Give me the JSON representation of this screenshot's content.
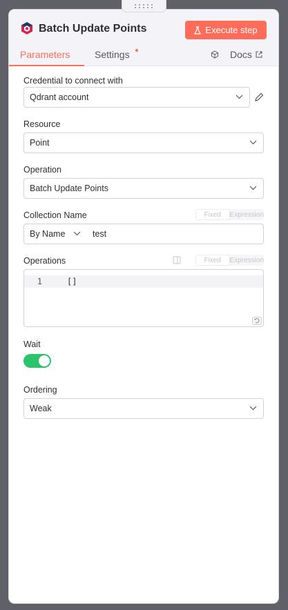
{
  "node": {
    "title": "Batch Update Points",
    "execute_label": "Execute step",
    "accent": "#ff6d5a",
    "icon": "qdrant-icon"
  },
  "tabs": {
    "parameters": "Parameters",
    "settings": "Settings",
    "docs": "Docs"
  },
  "fields": {
    "credential": {
      "label": "Credential to connect with",
      "value": "Qdrant account"
    },
    "resource": {
      "label": "Resource",
      "value": "Point"
    },
    "operation": {
      "label": "Operation",
      "value": "Batch Update Points"
    },
    "collection": {
      "label": "Collection Name",
      "mode": "By Name",
      "value": "test",
      "fixed": "Fixed",
      "expression": "Expression"
    },
    "operations": {
      "label": "Operations",
      "line_number": "1",
      "code": "[]",
      "fixed": "Fixed",
      "expression": "Expression"
    },
    "wait": {
      "label": "Wait",
      "on": true,
      "color": "#29c46b"
    },
    "ordering": {
      "label": "Ordering",
      "value": "Weak"
    }
  }
}
